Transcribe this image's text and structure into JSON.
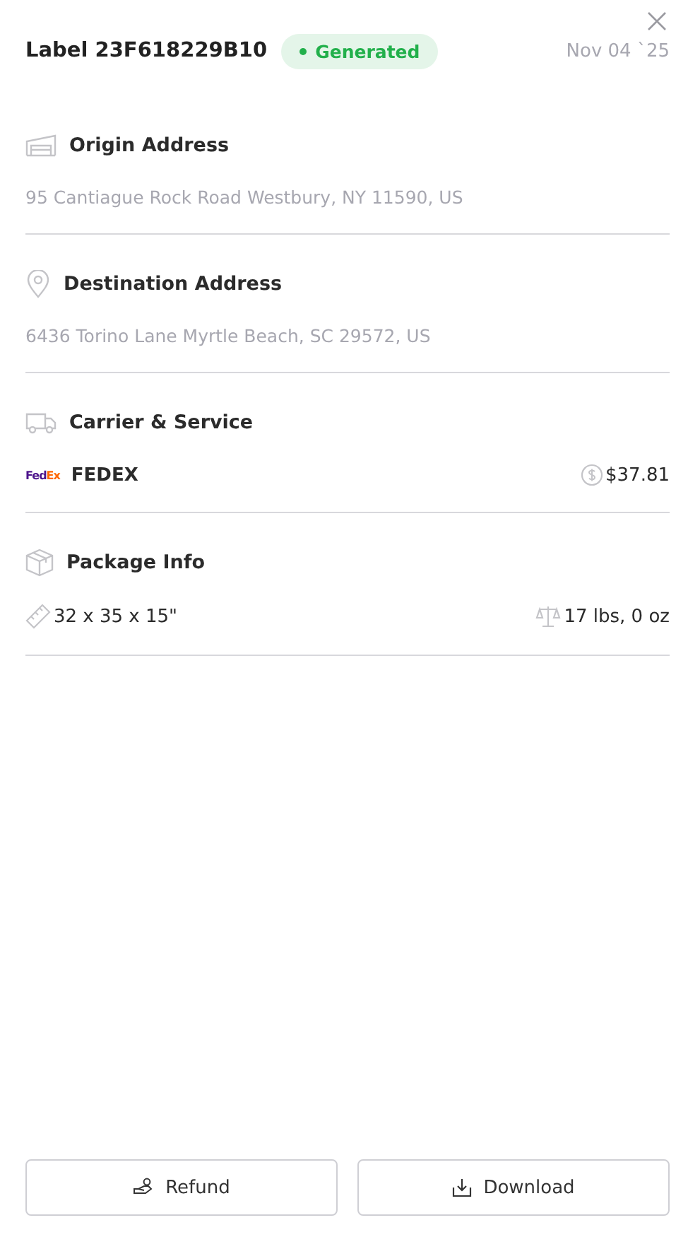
{
  "header": {
    "title": "Label 23F618229B10",
    "status": {
      "label": "Generated",
      "color": "#22b04b"
    },
    "date": "Nov 04 `25"
  },
  "sections": [
    {
      "kind": "origin",
      "title": "Origin Address",
      "text": "95 Cantiague Rock Road Westbury, NY 11590, US"
    },
    {
      "kind": "destination",
      "title": "Destination Address",
      "text": "6436 Torino Lane Myrtle Beach, SC 29572, US"
    },
    {
      "kind": "carrier",
      "title": "Carrier & Service",
      "logo_parts": [
        "Fed",
        "Ex"
      ],
      "carrier": "FEDEX",
      "price": "$37.81"
    },
    {
      "kind": "package",
      "title": "Package Info",
      "dimensions": "32 x 35 x 15\"",
      "weight": "17 lbs, 0 oz"
    }
  ],
  "buttons": [
    {
      "kind": "refund",
      "label": "Refund"
    },
    {
      "kind": "download",
      "label": "Download"
    }
  ]
}
